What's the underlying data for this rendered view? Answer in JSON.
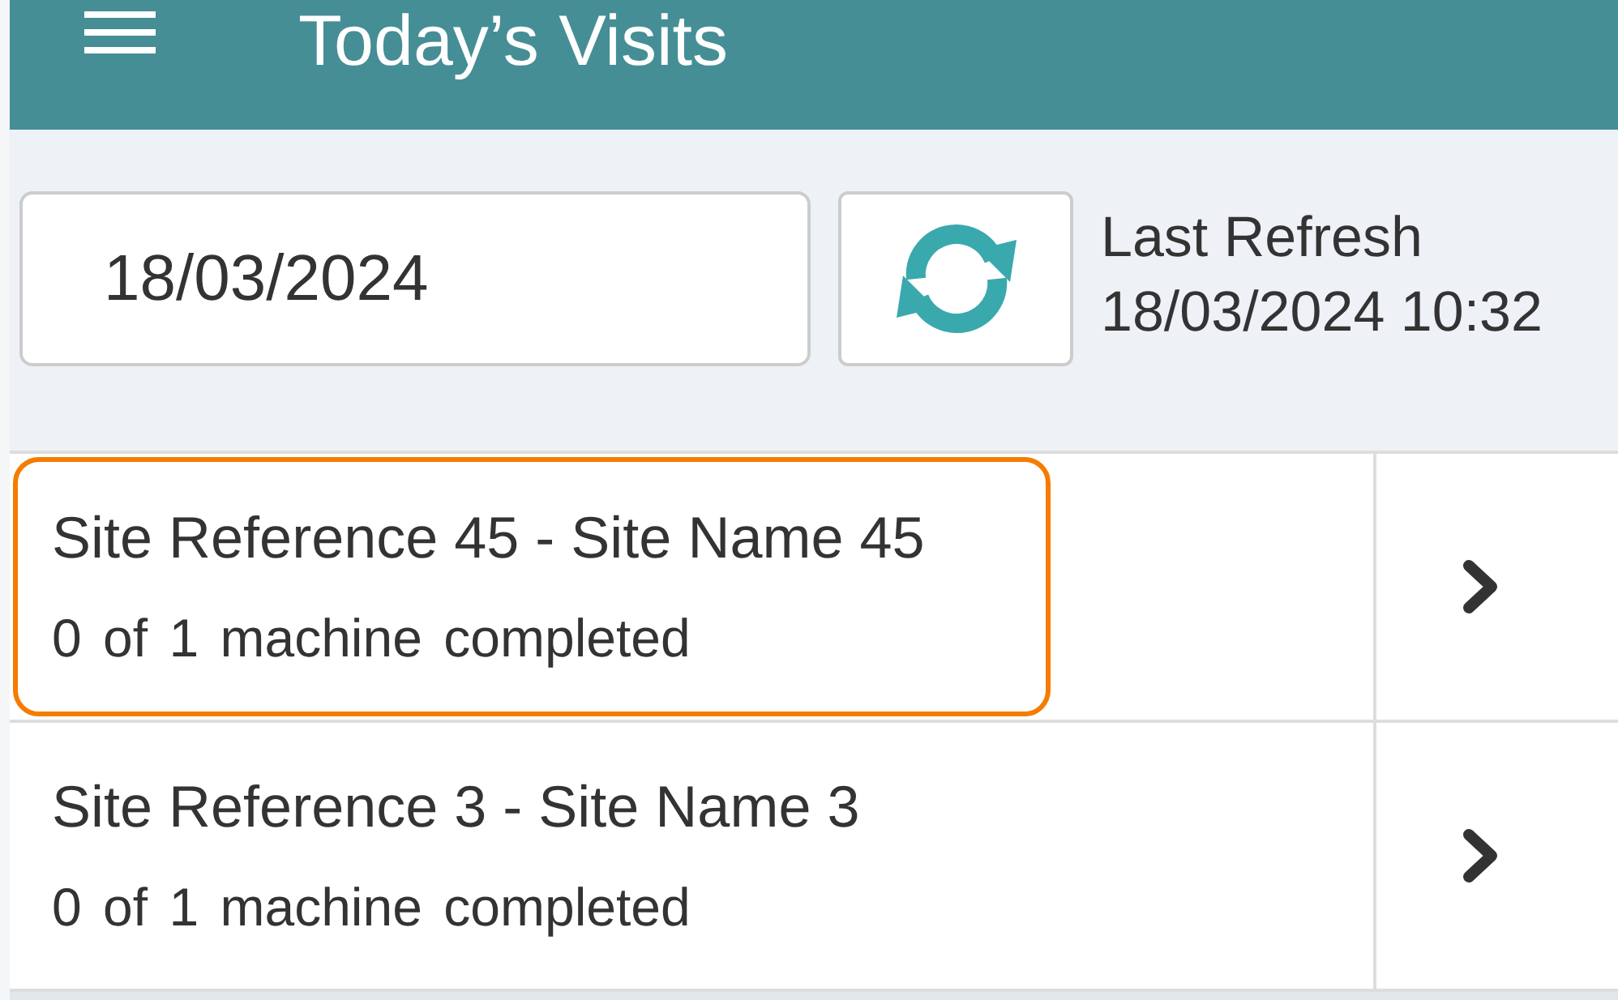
{
  "header": {
    "title": "Today’s Visits"
  },
  "date_field": {
    "value": "18/03/2024"
  },
  "last_refresh": {
    "label": "Last Refresh",
    "value": "18/03/2024 10:32"
  },
  "visits": [
    {
      "title": "Site Reference 45  -  Site Name 45",
      "progress": "0 of 1 machine completed",
      "selected": true
    },
    {
      "title": "Site Reference 3  -  Site Name 3",
      "progress": "0 of 1 machine completed",
      "selected": false
    }
  ]
}
